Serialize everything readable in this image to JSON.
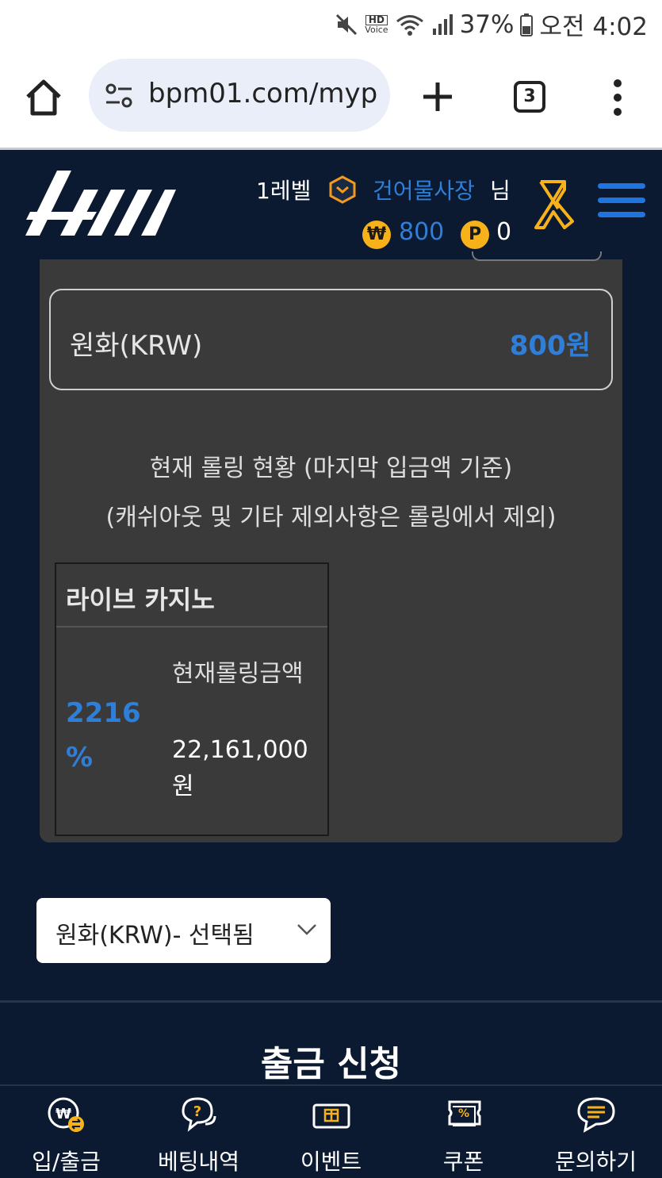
{
  "status_bar": {
    "battery": "37%",
    "time": "오전 4:02",
    "hd_voice_top": "HD",
    "hd_voice_bottom": "Voice"
  },
  "browser": {
    "url": "bpm01.com/myp",
    "tab_count": "3"
  },
  "header": {
    "level": "1레벨",
    "username": "건어물사장",
    "suffix": "님",
    "won_symbol": "₩",
    "won_balance": "800",
    "point_symbol": "P",
    "point_balance": "0"
  },
  "panel": {
    "currency_label": "원화(KRW)",
    "currency_value": "800원",
    "rolling_title": "현재 롤링 현황 (마지막 입금액 기준)",
    "rolling_sub": "(캐쉬아웃 및 기타 제외사항은 롤링에서 제외)",
    "card": {
      "title": "라이브 카지노",
      "percent": "2216 %",
      "label": "현재롤링금액",
      "amount": "22,161,000원"
    }
  },
  "currency_select": {
    "value": "원화(KRW)- 선택됨"
  },
  "withdraw_title": "출금 신청",
  "bottom_nav": [
    {
      "label": "입/출금",
      "icon": "deposit-withdraw-icon"
    },
    {
      "label": "베팅내역",
      "icon": "question-chat-icon"
    },
    {
      "label": "이벤트",
      "icon": "gift-ticket-icon"
    },
    {
      "label": "쿠폰",
      "icon": "coupon-icon"
    },
    {
      "label": "문의하기",
      "icon": "chat-bubble-icon"
    }
  ],
  "colors": {
    "accent_blue": "#2f7ed8",
    "gold": "#f7b21b",
    "background": "#0b1a30",
    "panel": "#3a3a3a"
  }
}
